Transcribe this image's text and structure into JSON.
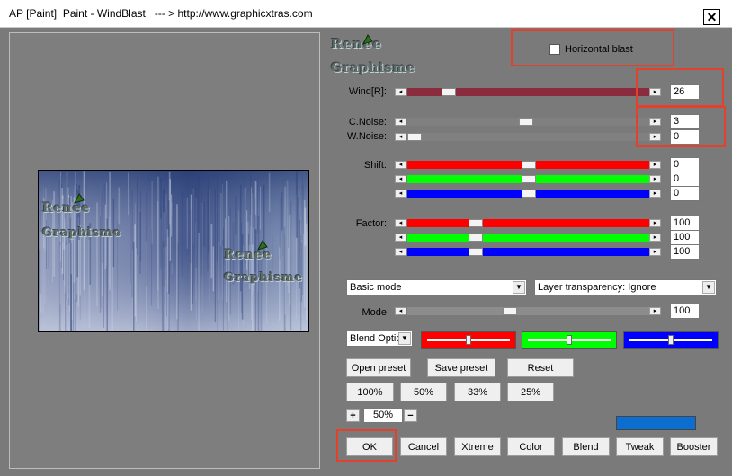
{
  "window": {
    "title": "AP [Paint]  Paint - WindBlast   --- > http://www.graphicxtras.com",
    "close_glyph": "✕"
  },
  "watermark": {
    "line1": "Renee",
    "line2": "Graphisme"
  },
  "horizontal_blast": {
    "label": "Horizontal blast",
    "checked": false
  },
  "wind": {
    "label": "Wind[R]:",
    "value": "26",
    "level": 0.15,
    "track_color": "#8b2c3e"
  },
  "c_noise": {
    "label": "C.Noise:",
    "value": "3",
    "level": 0.49,
    "track_color": "#808080"
  },
  "w_noise": {
    "label": "W.Noise:",
    "value": "0",
    "level": 0.0,
    "track_color": "#808080"
  },
  "shift": {
    "label": "Shift:",
    "rows": [
      {
        "color": "#ff0000",
        "value": "0",
        "level": 0.5
      },
      {
        "color": "#00ff00",
        "value": "0",
        "level": 0.5
      },
      {
        "color": "#0000ff",
        "value": "0",
        "level": 0.5
      }
    ]
  },
  "factor": {
    "label": "Factor:",
    "rows": [
      {
        "color": "#ff0000",
        "value": "100",
        "level": 0.27
      },
      {
        "color": "#00ff00",
        "value": "100",
        "level": 0.27
      },
      {
        "color": "#0000ff",
        "value": "100",
        "level": 0.27
      }
    ]
  },
  "mode_select": {
    "value": "Basic mode"
  },
  "layer_select": {
    "value": "Layer transparency: Ignore"
  },
  "mode": {
    "label": "Mode",
    "value": "100",
    "level": 0.42
  },
  "blend_select": {
    "value": "Blend Optio"
  },
  "blend_colors": [
    {
      "color": "#ff0000",
      "level": 0.5
    },
    {
      "color": "#00ff00",
      "level": 0.5
    },
    {
      "color": "#0000ff",
      "level": 0.5
    }
  ],
  "buttons": {
    "open_preset": "Open preset",
    "save_preset": "Save preset",
    "reset": "Reset",
    "zoom_100": "100%",
    "zoom_50": "50%",
    "zoom_33": "33%",
    "zoom_25": "25%",
    "ok": "OK",
    "cancel": "Cancel",
    "xtreme": "Xtreme",
    "color": "Color",
    "blend": "Blend",
    "tweak": "Tweak",
    "booster": "Booster"
  },
  "zoom": {
    "plus": "+",
    "minus": "−",
    "value": "50%"
  },
  "swatch_color": "#0a6fd1",
  "arrow_left": "◂",
  "arrow_right": "▸",
  "arrow_down": "▼"
}
